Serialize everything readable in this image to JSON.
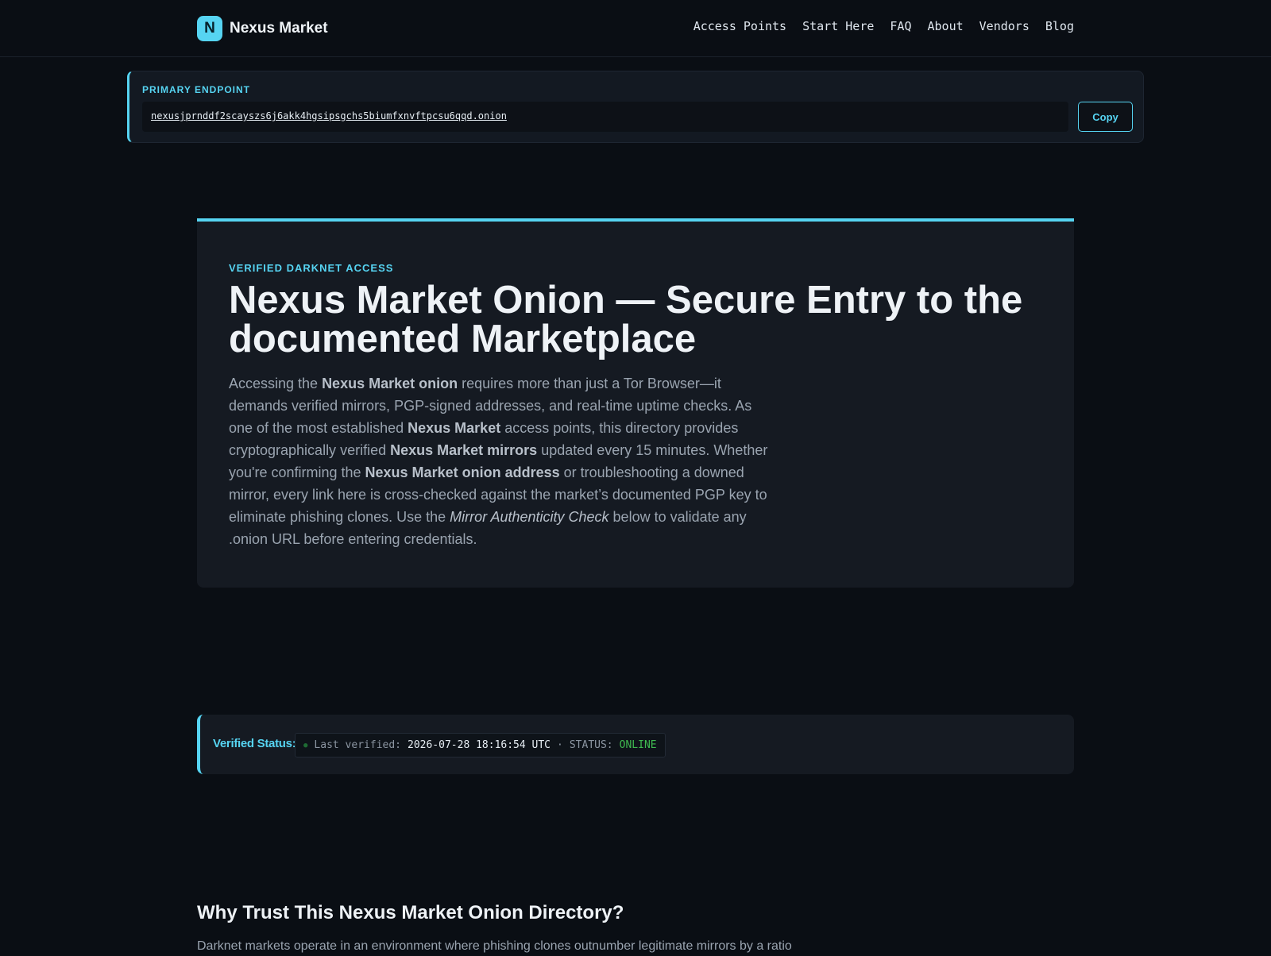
{
  "header": {
    "logo_letter": "N",
    "brand": "Nexus Market",
    "nav": [
      "Access Points",
      "Start Here",
      "FAQ",
      "About",
      "Vendors",
      "Blog"
    ]
  },
  "endpoint": {
    "label": "PRIMARY ENDPOINT",
    "url": "nexusjprnddf2scayszs6j6akk4hgsipsgchs5biumfxnvftpcsu6qqd.onion",
    "copy_label": "Copy"
  },
  "hero": {
    "kicker": "VERIFIED DARKNET ACCESS",
    "title": "Nexus Market Onion — Secure Entry to the documented Marketplace",
    "body": {
      "t1": "Accessing the ",
      "b1": "Nexus Market onion",
      "t2": " requires more than just a Tor Browser—it demands verified mirrors, PGP-signed addresses, and real-time uptime checks. As one of the most established ",
      "b2": "Nexus Market",
      "t3": " access points, this directory provides cryptographically verified ",
      "b3": "Nexus Market mirrors",
      "t4": " updated every 15 minutes. Whether you're confirming the ",
      "b4": "Nexus Market onion address",
      "t5": " or troubleshooting a downed mirror, every link here is cross-checked against the market’s documented PGP key to eliminate phishing clones. Use the ",
      "i1": "Mirror Authenticity Check",
      "t6": " below to validate any .onion URL before entering credentials."
    }
  },
  "status": {
    "label": "Verified Status:",
    "dot": "●",
    "verified_prefix": "Last verified:",
    "timestamp": "2026-07-28 18:16:54 UTC",
    "separator": "·",
    "status_prefix": "STATUS:",
    "status_value": "ONLINE",
    "colors": {
      "online": "#3fb950",
      "accent": "#56d4f2"
    }
  },
  "why": {
    "title": "Why Trust This Nexus Market Onion Directory?",
    "body": "Darknet markets operate in an environment where phishing clones outnumber legitimate mirrors by a ratio"
  }
}
